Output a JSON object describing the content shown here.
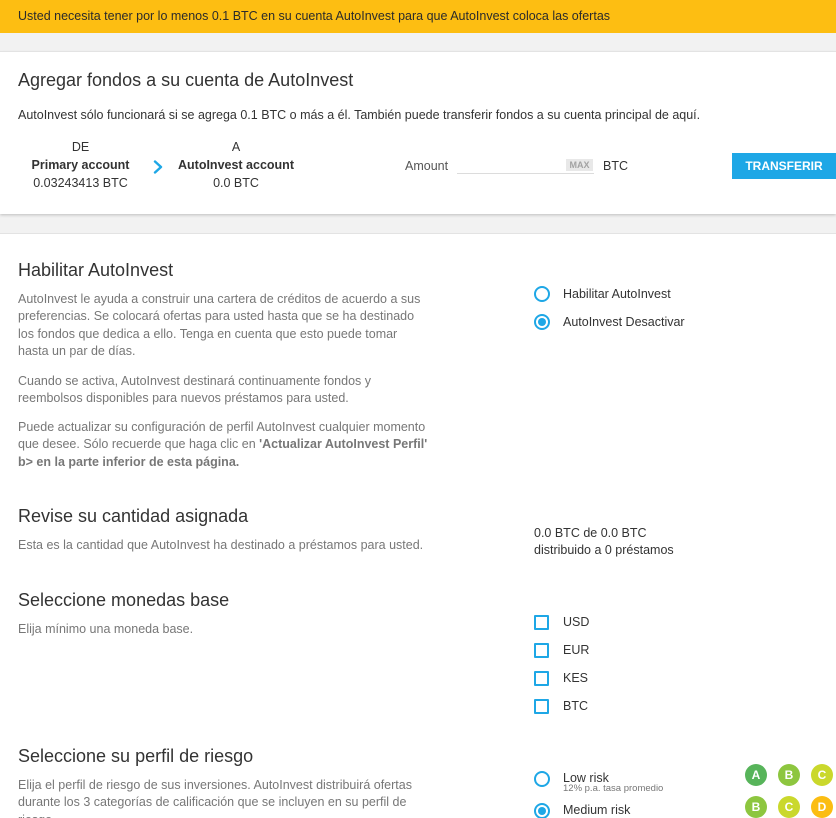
{
  "banner": {
    "text": "Usted necesita tener por lo menos 0.1 BTC en su cuenta AutoInvest para que AutoInvest coloca las ofertas"
  },
  "add_funds": {
    "title": "Agregar fondos a su cuenta de AutoInvest",
    "description": "AutoInvest sólo funcionará si se agrega 0.1 BTC o más a él. También puede transferir fondos a su cuenta principal de aquí.",
    "from": {
      "label": "DE",
      "account": "Primary account",
      "balance": "0.03243413 BTC"
    },
    "to": {
      "label": "A",
      "account": "AutoInvest account",
      "balance": "0.0 BTC"
    },
    "direction_icon": "chevron-right-icon",
    "amount": {
      "label": "Amount",
      "value": "",
      "max_label": "MAX",
      "currency": "BTC"
    },
    "submit_label": "TRANSFERIR"
  },
  "enable": {
    "title": "Habilitar AutoInvest",
    "paragraph_1": "AutoInvest le ayuda a construir una cartera de créditos de acuerdo a sus preferencias. Se colocará ofertas para usted hasta que se ha destinado los fondos que dedica a ello. Tenga en cuenta que esto puede tomar hasta un par de días.",
    "paragraph_2": "Cuando se activa, AutoInvest destinará continuamente fondos y reembolsos disponibles para nuevos préstamos para usted.",
    "paragraph_3": {
      "text": "Puede actualizar su configuración de perfil AutoInvest cualquier momento que desee. Sólo recuerde que haga clic en ",
      "bold": "'Actualizar AutoInvest Perfil' b> en la parte inferior de esta página."
    },
    "options": [
      {
        "label": "Habilitar AutoInvest",
        "selected": false
      },
      {
        "label": "AutoInvest Desactivar",
        "selected": true
      }
    ]
  },
  "allocation": {
    "title": "Revise su cantidad asignada",
    "description": "Esta es la cantidad que AutoInvest ha destinado a préstamos para usted.",
    "summary": "0.0 BTC de 0.0 BTC",
    "loans": "distribuido a 0 préstamos"
  },
  "currencies": {
    "title": "Seleccione monedas base",
    "description": "Elija mínimo una moneda base.",
    "options": [
      {
        "label": "USD",
        "checked": false
      },
      {
        "label": "EUR",
        "checked": false
      },
      {
        "label": "KES",
        "checked": false
      },
      {
        "label": "BTC",
        "checked": false
      }
    ]
  },
  "risk": {
    "title": "Seleccione su perfil de riesgo",
    "description": "Elija el perfil de riesgo de sus inversiones. AutoInvest distribuirá ofertas durante los 3 categorías de calificación que se incluyen en su perfil de riesgo.",
    "options": [
      {
        "label": "Low risk",
        "note": "12% p.a. tasa promedio",
        "selected": false,
        "grades": [
          "A",
          "B",
          "C"
        ]
      },
      {
        "label": "Medium risk",
        "selected": true,
        "grades": [
          "B",
          "C",
          "D"
        ]
      }
    ]
  },
  "colors": {
    "banner": "#fdbe12",
    "accent": "#1ea7e6",
    "grades": {
      "A": "#57b45a",
      "B": "#8dc63f",
      "C": "#cad82c",
      "D": "#fbbd12"
    }
  }
}
